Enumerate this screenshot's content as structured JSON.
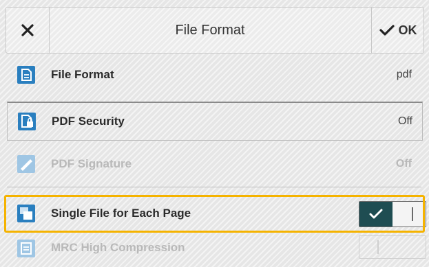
{
  "header": {
    "title": "File Format",
    "ok_label": "OK"
  },
  "rows": [
    {
      "label": "File Format",
      "value": "pdf",
      "icon": "file-format-icon"
    },
    {
      "label": "PDF Security",
      "value": "Off",
      "icon": "pdf-security-icon"
    },
    {
      "label": "PDF Signature",
      "value": "Off",
      "icon": "pdf-signature-icon",
      "disabled": true
    },
    {
      "label": "Single File for Each Page",
      "toggle": "on",
      "icon": "single-file-icon"
    },
    {
      "label": "MRC High Compression",
      "toggle": "off",
      "icon": "mrc-compression-icon",
      "disabled": true
    }
  ],
  "colors": {
    "accent": "#2a7fbf",
    "toggle_on": "#1f4d52",
    "highlight": "#f5b300"
  }
}
